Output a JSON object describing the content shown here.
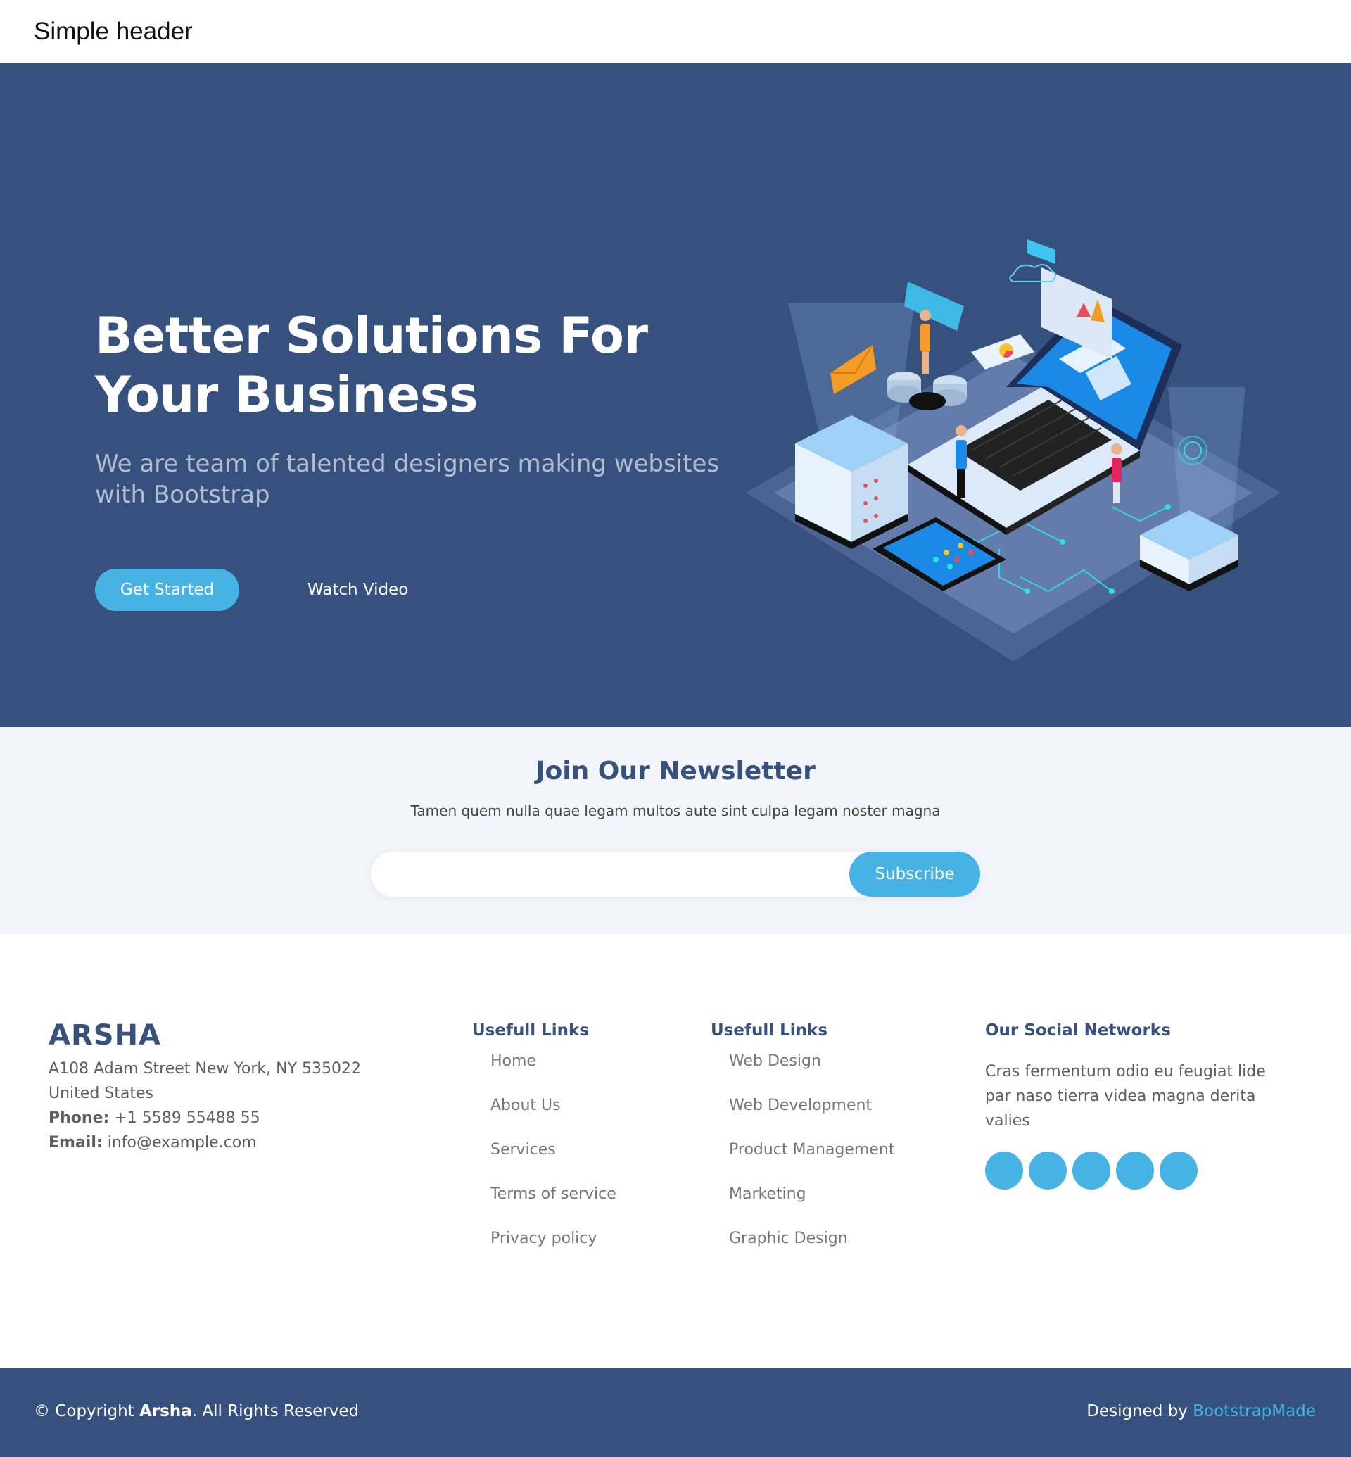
{
  "header": {
    "title": "Simple header"
  },
  "hero": {
    "title": "Better Solutions For Your Business",
    "subtitle": "We are team of talented designers making websites with Bootstrap",
    "primary_button": "Get Started",
    "secondary_button": "Watch Video",
    "illustration": "isometric-laptop-servers-illustration"
  },
  "newsletter": {
    "title": "Join Our Newsletter",
    "text": "Tamen quem nulla quae legam multos aute sint culpa legam noster magna",
    "email_value": "",
    "button": "Subscribe"
  },
  "footer": {
    "brand": "ARSHA",
    "address_line1": "A108 Adam Street New York, NY 535022",
    "address_line2": "United States",
    "phone_label": "Phone:",
    "phone": "+1 5589 55488 55",
    "email_label": "Email:",
    "email": "info@example.com",
    "links1": {
      "title": "Usefull Links",
      "items": [
        "Home",
        "About Us",
        "Services",
        "Terms of service",
        "Privacy policy"
      ]
    },
    "links2": {
      "title": "Usefull Links",
      "items": [
        "Web Design",
        "Web Development",
        "Product Management",
        "Marketing",
        "Graphic Design"
      ]
    },
    "social": {
      "title": "Our Social Networks",
      "text": "Cras fermentum odio eu feugiat lide par naso tierra videa magna derita valies",
      "icons": [
        "social-icon-1",
        "social-icon-2",
        "social-icon-3",
        "social-icon-4",
        "social-icon-5"
      ]
    }
  },
  "bottom": {
    "copyright_prefix": "© Copyright ",
    "copyright_brand": "Arsha",
    "copyright_suffix": ". All Rights Reserved",
    "designed_by": "Designed by ",
    "designer": "BootstrapMade"
  },
  "colors": {
    "primary": "#37517e",
    "accent": "#47b2e4",
    "light_bg": "#f3f5fa"
  }
}
